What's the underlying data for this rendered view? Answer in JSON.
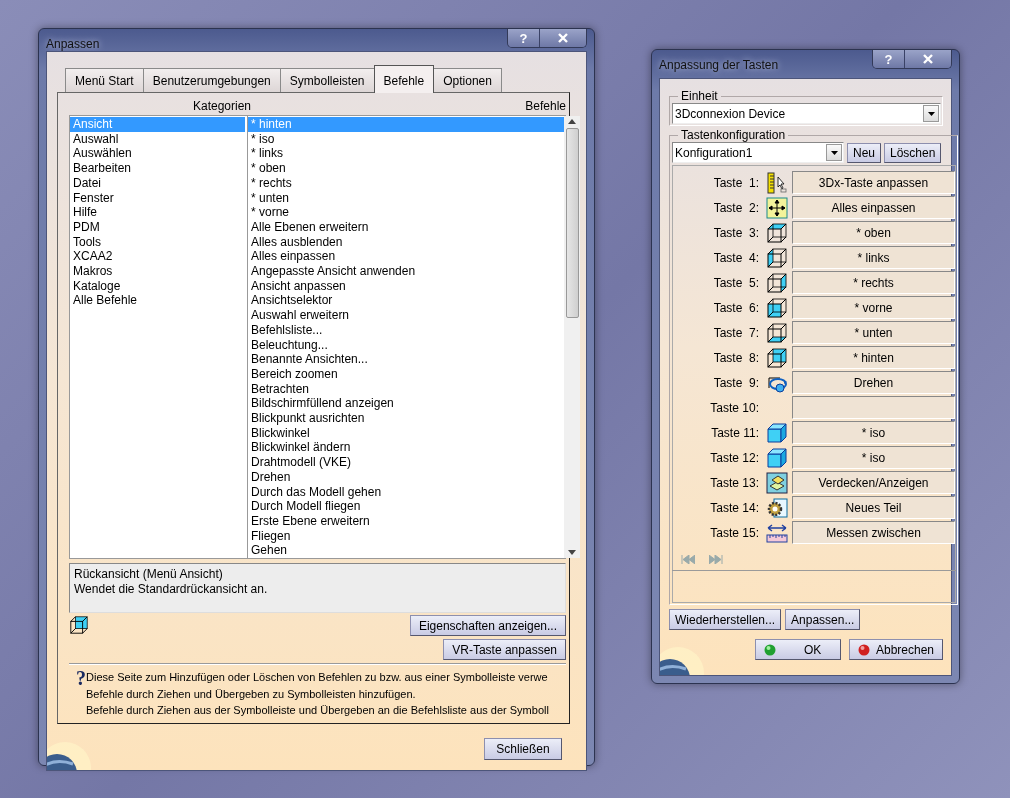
{
  "customize_dialog": {
    "title": "Anpassen",
    "help_button": "?",
    "tabs": [
      {
        "label": "Menü Start",
        "selected": false
      },
      {
        "label": "Benutzerumgebungen",
        "selected": false
      },
      {
        "label": "Symbolleisten",
        "selected": false
      },
      {
        "label": "Befehle",
        "selected": true
      },
      {
        "label": "Optionen",
        "selected": false
      }
    ],
    "categories_header": "Kategorien",
    "commands_header": "Befehle",
    "categories": [
      {
        "label": "Ansicht",
        "selected": true
      },
      {
        "label": "Auswahl",
        "selected": false
      },
      {
        "label": "Auswählen",
        "selected": false
      },
      {
        "label": "Bearbeiten",
        "selected": false
      },
      {
        "label": "Datei",
        "selected": false
      },
      {
        "label": "Fenster",
        "selected": false
      },
      {
        "label": "Hilfe",
        "selected": false
      },
      {
        "label": "PDM",
        "selected": false
      },
      {
        "label": "Tools",
        "selected": false
      },
      {
        "label": "XCAA2",
        "selected": false
      },
      {
        "label": "Makros",
        "selected": false
      },
      {
        "label": "Kataloge",
        "selected": false
      },
      {
        "label": "Alle Befehle",
        "selected": false
      }
    ],
    "commands": [
      {
        "label": "* hinten",
        "selected": true
      },
      {
        "label": "* iso",
        "selected": false
      },
      {
        "label": "* links",
        "selected": false
      },
      {
        "label": "* oben",
        "selected": false
      },
      {
        "label": "* rechts",
        "selected": false
      },
      {
        "label": "* unten",
        "selected": false
      },
      {
        "label": "* vorne",
        "selected": false
      },
      {
        "label": "Alle Ebenen erweitern",
        "selected": false
      },
      {
        "label": "Alles ausblenden",
        "selected": false
      },
      {
        "label": "Alles einpassen",
        "selected": false
      },
      {
        "label": "Angepasste Ansicht anwenden",
        "selected": false
      },
      {
        "label": "Ansicht anpassen",
        "selected": false
      },
      {
        "label": "Ansichtselektor",
        "selected": false
      },
      {
        "label": "Auswahl erweitern",
        "selected": false
      },
      {
        "label": "Befehlsliste...",
        "selected": false
      },
      {
        "label": "Beleuchtung...",
        "selected": false
      },
      {
        "label": "Benannte Ansichten...",
        "selected": false
      },
      {
        "label": "Bereich zoomen",
        "selected": false
      },
      {
        "label": "Betrachten",
        "selected": false
      },
      {
        "label": "Bildschirmfüllend anzeigen",
        "selected": false
      },
      {
        "label": "Blickpunkt ausrichten",
        "selected": false
      },
      {
        "label": "Blickwinkel",
        "selected": false
      },
      {
        "label": "Blickwinkel ändern",
        "selected": false
      },
      {
        "label": "Drahtmodell (VKE)",
        "selected": false
      },
      {
        "label": "Drehen",
        "selected": false
      },
      {
        "label": "Durch das Modell gehen",
        "selected": false
      },
      {
        "label": "Durch Modell fliegen",
        "selected": false
      },
      {
        "label": "Erste Ebene erweitern",
        "selected": false
      },
      {
        "label": "Fliegen",
        "selected": false
      },
      {
        "label": "Gehen",
        "selected": false
      }
    ],
    "description": {
      "title": "Rückansicht (Menü Ansicht)",
      "text": "Wendet die Standardrückansicht an."
    },
    "action_buttons": [
      "Eigenschaften anzeigen...",
      "VR-Taste anpassen"
    ],
    "help_mark": "?",
    "help_lines": [
      "Diese Seite zum Hinzufügen oder Löschen von Befehlen zu bzw. aus einer Symbolleiste verwe",
      "Befehle durch Ziehen und Übergeben zu Symbolleisten hinzufügen.",
      "Befehle durch Ziehen aus der Symbolleiste und Übergeben an die Befehlsliste aus der Symboll"
    ],
    "close_button": "Schließen"
  },
  "button_dialog": {
    "title": "Anpassung der Tasten",
    "help_button": "?",
    "unit_label": "Einheit",
    "unit_value": "3Dconnexion Device",
    "config_label": "Tastenkonfiguration",
    "config_value": "Konfiguration1",
    "config_buttons": [
      "Neu",
      "Löschen"
    ],
    "keys": [
      {
        "label": "Taste  1:",
        "command": "3Dx-Taste anpassen",
        "kind": "ruler"
      },
      {
        "label": "Taste  2:",
        "command": "Alles einpassen",
        "kind": "fit"
      },
      {
        "label": "Taste  3:",
        "command": "* oben",
        "kind": "top"
      },
      {
        "label": "Taste  4:",
        "command": "* links",
        "kind": "left"
      },
      {
        "label": "Taste  5:",
        "command": "* rechts",
        "kind": "right"
      },
      {
        "label": "Taste  6:",
        "command": "* vorne",
        "kind": "front"
      },
      {
        "label": "Taste  7:",
        "command": "* unten",
        "kind": "bottom"
      },
      {
        "label": "Taste  8:",
        "command": "* hinten",
        "kind": "back"
      },
      {
        "label": "Taste  9:",
        "command": "Drehen",
        "kind": "rotate"
      },
      {
        "label": "Taste 10:",
        "kind": "none"
      },
      {
        "label": "Taste 11:",
        "command": "* iso",
        "kind": "iso"
      },
      {
        "label": "Taste 12:",
        "command": "* iso",
        "kind": "iso"
      },
      {
        "label": "Taste 13:",
        "command": "Verdecken/Anzeigen",
        "kind": "hideshow"
      },
      {
        "label": "Taste 14:",
        "command": "Neues Teil",
        "kind": "part"
      },
      {
        "label": "Taste 15:",
        "command": "Messen zwischen",
        "kind": "measure"
      }
    ],
    "footer_buttons": [
      "Wiederherstellen...",
      "Anpassen..."
    ],
    "ok_button": "OK",
    "cancel_button": "Abbrechen"
  }
}
